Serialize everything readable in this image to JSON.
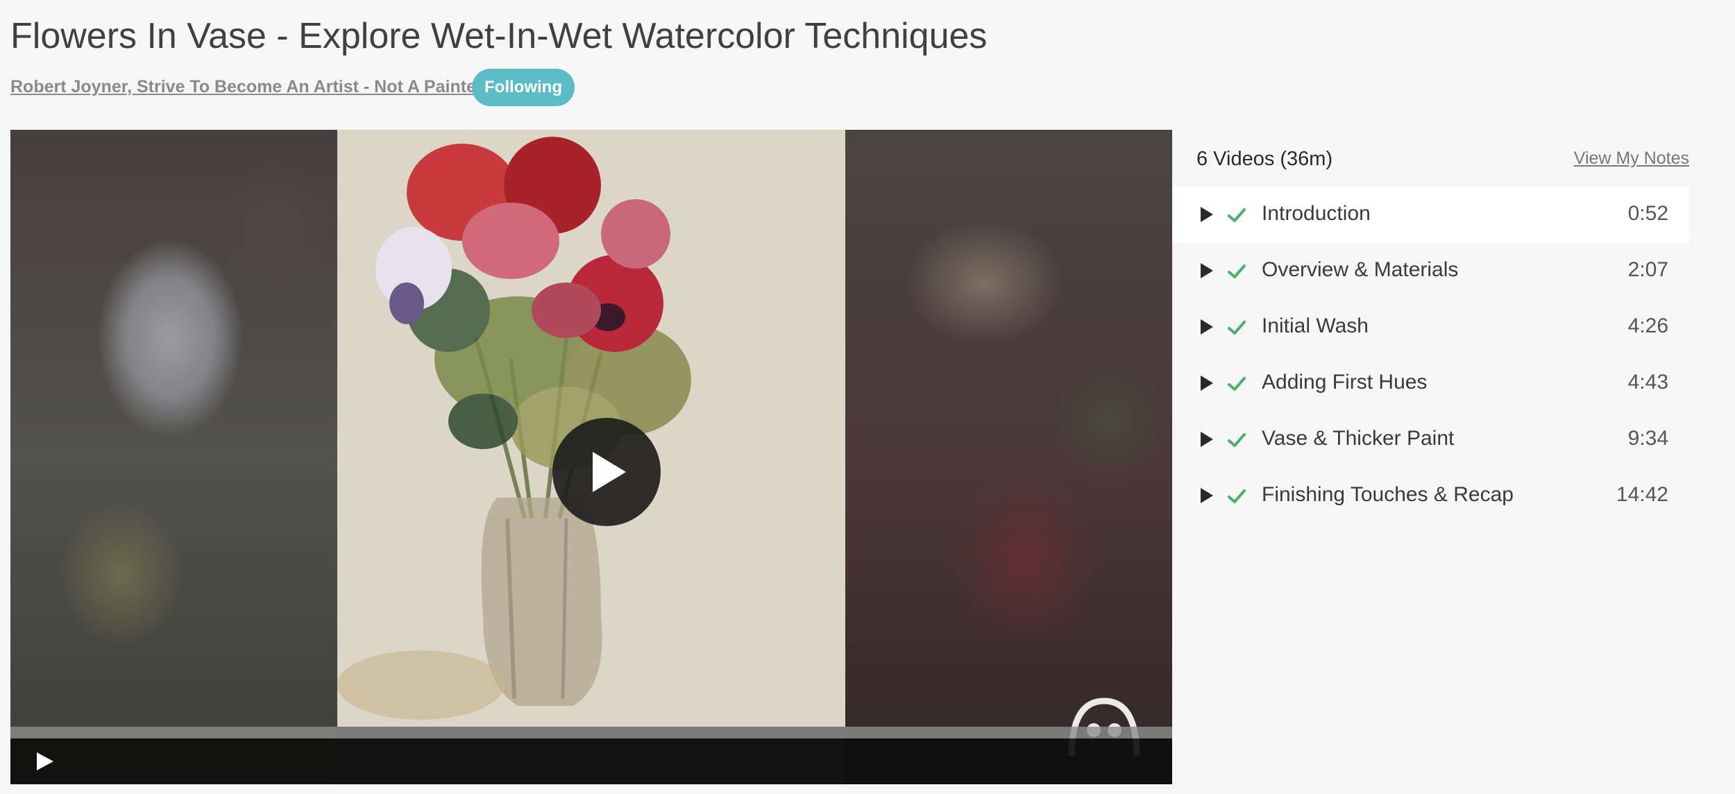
{
  "course": {
    "title": "Flowers In Vase - Explore Wet-In-Wet Watercolor Techniques",
    "author": "Robert Joyner, Strive To Become An Artist - Not A Painter",
    "follow_label": "Following"
  },
  "player": {
    "progress": 0
  },
  "sidebar": {
    "count_label": "6 Videos (36m)",
    "notes_label": "View My Notes",
    "lessons": [
      {
        "title": "Introduction",
        "duration": "0:52",
        "completed": true,
        "active": true
      },
      {
        "title": "Overview & Materials",
        "duration": "2:07",
        "completed": true,
        "active": false
      },
      {
        "title": "Initial Wash",
        "duration": "4:26",
        "completed": true,
        "active": false
      },
      {
        "title": "Adding First Hues",
        "duration": "4:43",
        "completed": true,
        "active": false
      },
      {
        "title": "Vase & Thicker Paint",
        "duration": "9:34",
        "completed": true,
        "active": false
      },
      {
        "title": "Finishing Touches & Recap",
        "duration": "14:42",
        "completed": true,
        "active": false
      }
    ]
  },
  "colors": {
    "accent": "#5cbcc5",
    "check": "#4caf6a"
  },
  "icons": [
    "play-icon",
    "check-icon",
    "brand-logo-icon"
  ]
}
